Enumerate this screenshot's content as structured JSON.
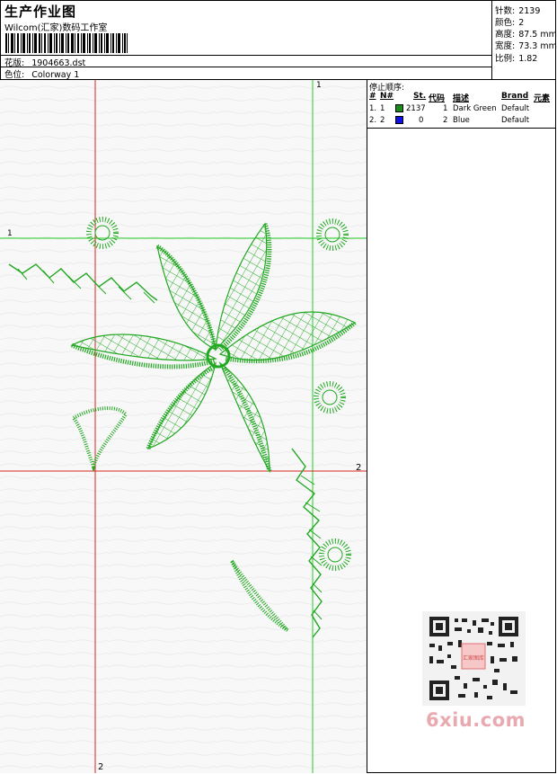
{
  "header": {
    "title": "生产作业图",
    "company": "Wilcom(汇家)数码工作室",
    "design_label": "花版:",
    "design_value": "1904663.dst",
    "colorway_label": "色位:",
    "colorway_value": "Colorway 1"
  },
  "stats": [
    {
      "label": "针数:",
      "value": "2139"
    },
    {
      "label": "颜色:",
      "value": "2"
    },
    {
      "label": "高度:",
      "value": "87.5 mm"
    },
    {
      "label": "宽度:",
      "value": "73.3 mm"
    },
    {
      "label": "比例:",
      "value": "1.82"
    }
  ],
  "stop_sequence": {
    "title": "停止顺序:",
    "columns": [
      "#",
      "N#",
      "St.",
      "代码",
      "描述",
      "Brand",
      "元素"
    ],
    "rows": [
      {
        "idx": "1.",
        "n": "1",
        "color": "#1a8a1a",
        "stitches": "2137",
        "code": "1",
        "desc": "Dark Green",
        "brand": "Default"
      },
      {
        "idx": "2.",
        "n": "2",
        "color": "#1010e0",
        "stitches": "0",
        "code": "2",
        "desc": "Blue",
        "brand": "Default"
      }
    ]
  },
  "canvas": {
    "guide_labels": {
      "h_green": "1",
      "v_green": "1",
      "h_red": "2",
      "v_red": "2"
    },
    "stitch_color": "#22a822",
    "green_guide_color": "#22cc22",
    "red_guide_color": "#dd2222"
  },
  "watermark": {
    "brand_text": "6xiu.com",
    "qr_label": "汇家图库"
  }
}
